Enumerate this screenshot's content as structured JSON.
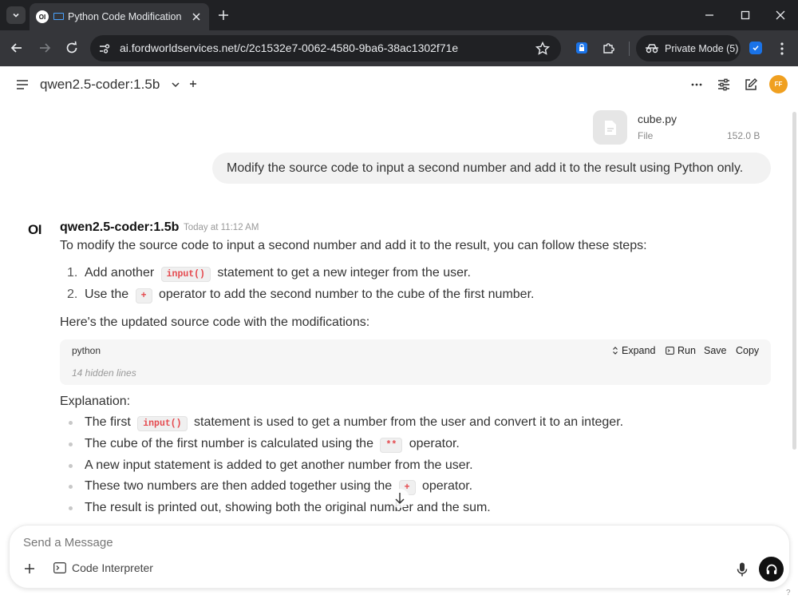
{
  "browser": {
    "tab_title": "Python Code Modification -",
    "tab_favicon_text": "OI",
    "url": "ai.fordworldservices.net/c/2c1532e7-0062-4580-9ba6-38ac1302f71e",
    "private_mode": "Private Mode (5)"
  },
  "header": {
    "model_name": "qwen2.5-coder:1.5b",
    "avatar_initials": "FF"
  },
  "attachment": {
    "name": "cube.py",
    "type": "File",
    "size": "152.0 B"
  },
  "user_message": "Modify the source code to input a second number and add it to the result using Python only.",
  "response": {
    "logo": "OI",
    "model_name": "qwen2.5-coder:1.5b",
    "timestamp": "Today at 11:12 AM",
    "intro": "To modify the source code to input a second number and add it to the result, you can follow these steps:",
    "steps": [
      {
        "num": "1.",
        "before": "Add another",
        "code": "input()",
        "after": "statement to get a new integer from the user."
      },
      {
        "num": "2.",
        "before": "Use the",
        "code": "+",
        "after": "operator to add the second number to the cube of the first number."
      }
    ],
    "code_intro": "Here's the updated source code with the modifications:",
    "code_block": {
      "language": "python",
      "hidden_lines": "14 hidden lines",
      "expand": "Expand",
      "run": "Run",
      "save": "Save",
      "copy": "Copy"
    },
    "explanation_label": "Explanation:",
    "explanation": [
      {
        "before": "The first",
        "code": "input()",
        "after": "statement is used to get a number from the user and convert it to an integer."
      },
      {
        "before": "The cube of the first number is calculated using the",
        "code": "**",
        "after": "operator."
      },
      {
        "before": "A new input statement is added to get another number from the user.",
        "code": "",
        "after": ""
      },
      {
        "before": "These two numbers are then added together using the",
        "code": "+",
        "after": "operator."
      },
      {
        "before": "The result is printed out, showing both the original number and the sum.",
        "code": "",
        "after": ""
      }
    ]
  },
  "composer": {
    "placeholder": "Send a Message",
    "code_interpreter": "Code Interpreter",
    "help": "?"
  }
}
